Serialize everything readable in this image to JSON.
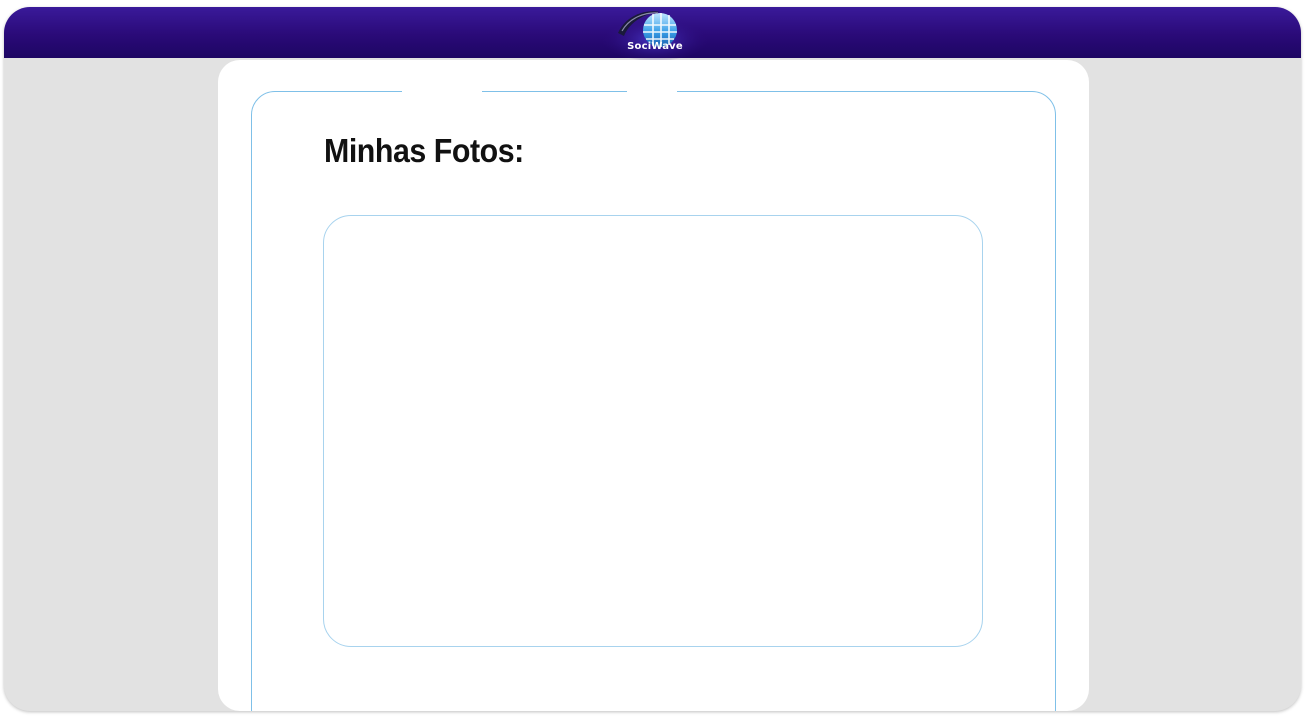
{
  "header": {
    "brand": "SociWave",
    "logo_icon": "globe-logo-icon",
    "colors": {
      "bar_top": "#3a1a9a",
      "bar_bottom": "#1d0663"
    }
  },
  "main": {
    "title": "Minhas Fotos:",
    "gallery": {
      "photos": []
    }
  },
  "colors": {
    "page_background": "#e2e2e2",
    "card_background": "#ffffff",
    "panel_border": "#7fc0e8"
  }
}
